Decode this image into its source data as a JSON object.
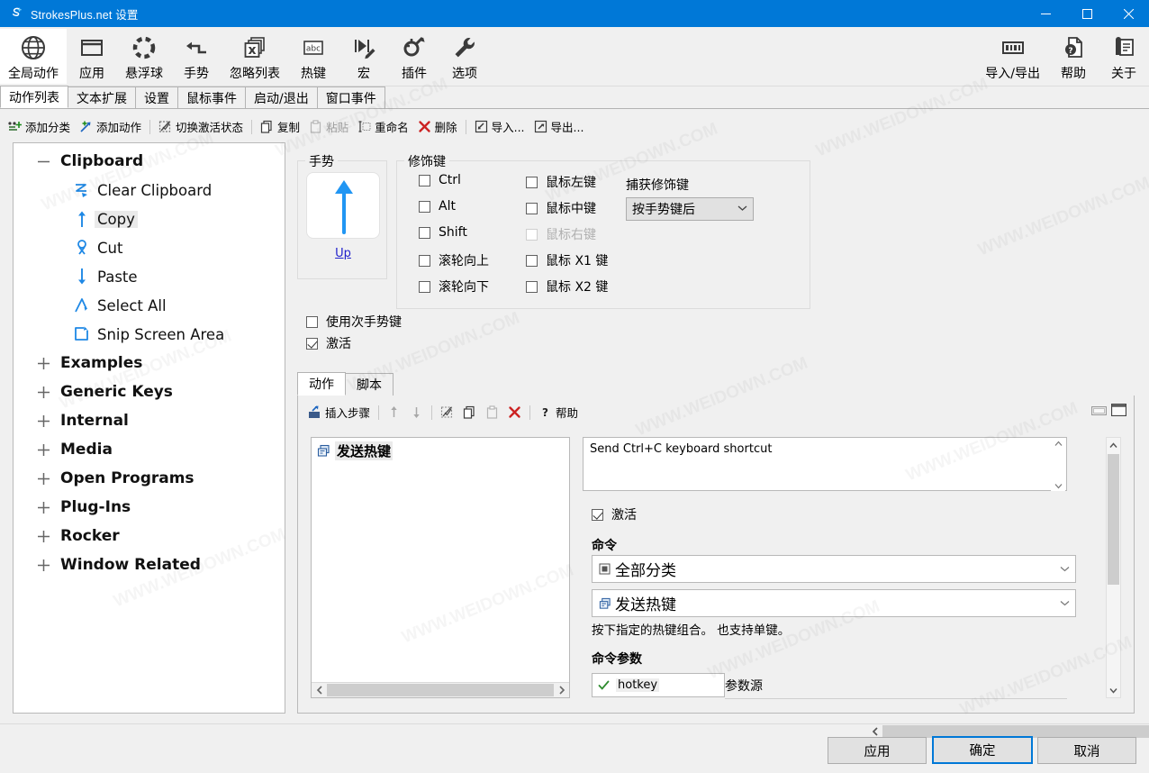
{
  "window": {
    "title": "StrokesPlus.net 设置",
    "app_icon": "strokesplus-logo-icon",
    "minimize": "—",
    "maximize": "□",
    "close": "✕"
  },
  "ribbon": {
    "items": [
      {
        "label": "全局动作",
        "icon": "globe-icon",
        "selected": true
      },
      {
        "label": "应用",
        "icon": "window-icon",
        "selected": false
      },
      {
        "label": "悬浮球",
        "icon": "dashed-circle-icon",
        "selected": false
      },
      {
        "label": "手势",
        "icon": "gesture-arrow-icon",
        "selected": false
      },
      {
        "label": "忽略列表",
        "icon": "ignore-list-icon",
        "selected": false
      },
      {
        "label": "热键",
        "icon": "abc-key-icon",
        "selected": false
      },
      {
        "label": "宏",
        "icon": "macro-play-icon",
        "selected": false
      },
      {
        "label": "插件",
        "icon": "plugin-icon",
        "selected": false
      },
      {
        "label": "选项",
        "icon": "wrench-icon",
        "selected": false
      }
    ],
    "right_items": [
      {
        "label": "导入/导出",
        "icon": "import-export-icon"
      },
      {
        "label": "帮助",
        "icon": "help-doc-icon"
      },
      {
        "label": "关于",
        "icon": "about-icon"
      }
    ]
  },
  "tabs": [
    {
      "label": "动作列表",
      "active": true
    },
    {
      "label": "文本扩展",
      "active": false
    },
    {
      "label": "设置",
      "active": false
    },
    {
      "label": "鼠标事件",
      "active": false
    },
    {
      "label": "启动/退出",
      "active": false
    },
    {
      "label": "窗口事件",
      "active": false
    }
  ],
  "command_bar": [
    {
      "label": "添加分类",
      "icon": "add-category-icon",
      "disabled": false
    },
    {
      "label": "添加动作",
      "icon": "add-action-icon",
      "disabled": false
    },
    {
      "sep": true
    },
    {
      "label": "切换激活状态",
      "icon": "toggle-enabled-icon",
      "disabled": false
    },
    {
      "sep": true
    },
    {
      "label": "复制",
      "icon": "copy-icon",
      "disabled": false
    },
    {
      "label": "粘贴",
      "icon": "paste-icon",
      "disabled": true
    },
    {
      "label": "重命名",
      "icon": "rename-icon",
      "disabled": false
    },
    {
      "label": "删除",
      "icon": "delete-x-icon",
      "disabled": false
    },
    {
      "sep": true
    },
    {
      "label": "导入...",
      "icon": "import-icon",
      "disabled": false
    },
    {
      "label": "导出...",
      "icon": "export-icon",
      "disabled": false
    }
  ],
  "tree": {
    "groups": [
      {
        "label": "Clipboard",
        "expanded": true,
        "children": [
          {
            "label": "Clear Clipboard",
            "icon": "gesture-z-icon",
            "selected": false
          },
          {
            "label": "Copy",
            "icon": "gesture-up-icon",
            "selected": true
          },
          {
            "label": "Cut",
            "icon": "gesture-loop-icon",
            "selected": false
          },
          {
            "label": "Paste",
            "icon": "gesture-down-icon",
            "selected": false
          },
          {
            "label": "Select All",
            "icon": "gesture-caret-icon",
            "selected": false
          },
          {
            "label": "Snip Screen Area",
            "icon": "gesture-square-icon",
            "selected": false
          }
        ]
      },
      {
        "label": "Examples",
        "expanded": false,
        "children": []
      },
      {
        "label": "Generic Keys",
        "expanded": false,
        "children": []
      },
      {
        "label": "Internal",
        "expanded": false,
        "children": []
      },
      {
        "label": "Media",
        "expanded": false,
        "children": []
      },
      {
        "label": "Open Programs",
        "expanded": false,
        "children": []
      },
      {
        "label": "Plug-Ins",
        "expanded": false,
        "children": []
      },
      {
        "label": "Rocker",
        "expanded": false,
        "children": []
      },
      {
        "label": "Window Related",
        "expanded": false,
        "children": []
      }
    ]
  },
  "gesture": {
    "group_title": "手势",
    "name": "Up",
    "direction_icon": "arrow-up-icon"
  },
  "modifiers": {
    "group_title": "修饰键",
    "left_column": [
      {
        "label": "Ctrl",
        "checked": false,
        "disabled": false
      },
      {
        "label": "Alt",
        "checked": false,
        "disabled": false
      },
      {
        "label": "Shift",
        "checked": false,
        "disabled": false
      },
      {
        "label": "滚轮向上",
        "checked": false,
        "disabled": false
      },
      {
        "label": "滚轮向下",
        "checked": false,
        "disabled": false
      }
    ],
    "right_column": [
      {
        "label": "鼠标左键",
        "checked": false,
        "disabled": false
      },
      {
        "label": "鼠标中键",
        "checked": false,
        "disabled": false
      },
      {
        "label": "鼠标右键",
        "checked": false,
        "disabled": true
      },
      {
        "label": "鼠标 X1 键",
        "checked": false,
        "disabled": false
      },
      {
        "label": "鼠标 X2 键",
        "checked": false,
        "disabled": false
      }
    ],
    "capture_label": "捕获修饰键",
    "capture_value": "按手势键后"
  },
  "options": [
    {
      "label": "使用次手势键",
      "checked": false
    },
    {
      "label": "激活",
      "checked": true
    }
  ],
  "sub_tabs": [
    {
      "label": "动作",
      "active": true
    },
    {
      "label": "脚本",
      "active": false
    }
  ],
  "action_toolbar": [
    {
      "label": "插入步骤",
      "icon": "insert-step-icon",
      "disabled": false
    },
    {
      "sep": true
    },
    {
      "label": "",
      "icon": "move-up-arrow-icon",
      "disabled": true
    },
    {
      "label": "",
      "icon": "move-down-arrow-icon",
      "disabled": true
    },
    {
      "sep": true
    },
    {
      "label": "",
      "icon": "toggle-step-icon",
      "disabled": false
    },
    {
      "label": "",
      "icon": "copy-step-icon",
      "disabled": false
    },
    {
      "label": "",
      "icon": "paste-step-icon",
      "disabled": true
    },
    {
      "label": "",
      "icon": "delete-step-x-icon",
      "disabled": false
    },
    {
      "sep": true
    },
    {
      "label": "帮助",
      "icon": "question-mark-icon",
      "disabled": false
    }
  ],
  "panel_buttons": [
    {
      "icon": "restore-down-icon"
    },
    {
      "icon": "maximize-panel-icon"
    }
  ],
  "steps": [
    {
      "label": "发送热键",
      "icon": "send-hotkey-icon",
      "selected": true
    }
  ],
  "detail": {
    "description": "Send Ctrl+C keyboard shortcut",
    "enabled_label": "激活",
    "enabled_checked": true,
    "command_label": "命令",
    "category_value": "全部分类",
    "category_icon": "category-icon",
    "command_value": "发送热键",
    "command_icon": "send-hotkey-icon",
    "hint": "按下指定的热键组合。 也支持单键。",
    "params_label": "命令参数",
    "param_name": "hotkey",
    "param_check_icon": "green-check-icon",
    "param_source_label": "参数源"
  },
  "footer": {
    "apply": "应用",
    "ok": "确定",
    "cancel": "取消"
  },
  "colors": {
    "titlebar": "#0078d7",
    "accent": "#0078d7",
    "gesture_blue": "#2196f3",
    "tree_icon_blue": "#1e88e5",
    "delete_red": "#cc2222",
    "link": "#2222cc"
  },
  "watermark": "WWW.WEIDOWN.COM"
}
